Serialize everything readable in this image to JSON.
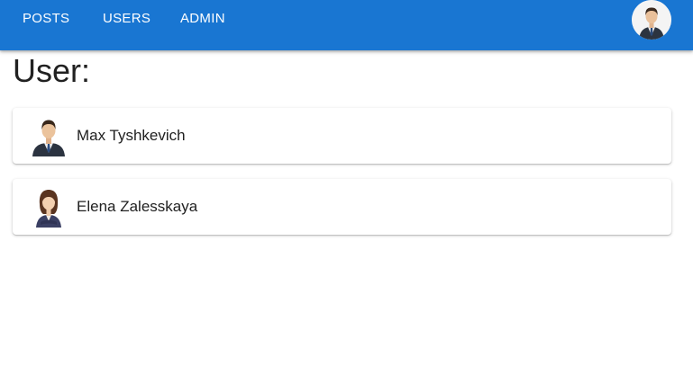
{
  "nav": {
    "items": [
      {
        "label": "POSTS"
      },
      {
        "label": "USERS"
      },
      {
        "label": "ADMIN"
      }
    ],
    "avatar_icon": "user-avatar-icon",
    "bar_color": "#1976d2"
  },
  "page": {
    "title": "User:"
  },
  "users": [
    {
      "name": "Max Tyshkevich",
      "avatar_icon": "businessman-avatar-icon"
    },
    {
      "name": "Elena Zalesskaya",
      "avatar_icon": "businesswoman-avatar-icon"
    }
  ]
}
